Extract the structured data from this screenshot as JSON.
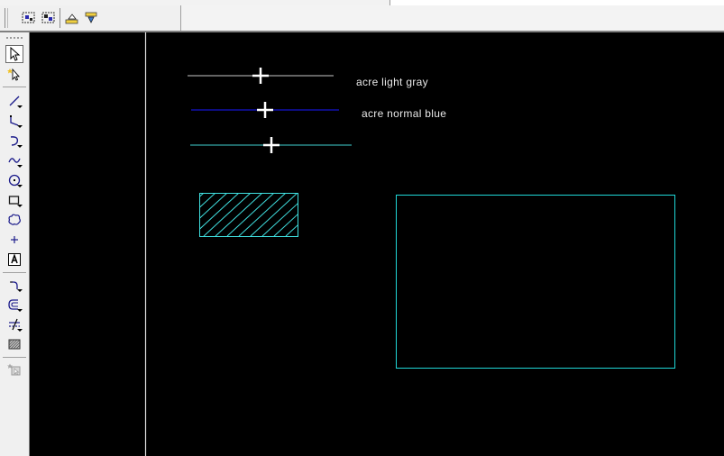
{
  "toolbar": {
    "buttons": [
      {
        "icon": "select-window-icon"
      },
      {
        "icon": "select-crossing-icon"
      },
      {
        "icon": "layer-raise-icon"
      },
      {
        "icon": "layer-lower-icon"
      }
    ]
  },
  "draw_tools": [
    {
      "icon": "pointer-icon",
      "active": true
    },
    {
      "icon": "magic-select-icon"
    },
    {
      "icon": "line-tool-icon"
    },
    {
      "icon": "polyline-tool-icon"
    },
    {
      "icon": "arc-tool-icon"
    },
    {
      "icon": "curve-tool-icon"
    },
    {
      "icon": "circle-tool-icon"
    },
    {
      "icon": "rectangle-tool-icon"
    },
    {
      "icon": "cloud-tool-icon"
    },
    {
      "icon": "point-tool-icon"
    },
    {
      "icon": "text-tool-icon"
    },
    {
      "icon": "fillet-tool-icon"
    },
    {
      "icon": "offset-tool-icon"
    },
    {
      "icon": "trim-tool-icon"
    },
    {
      "icon": "hatch-tool-icon"
    },
    {
      "icon": "disabled-edit-icon"
    }
  ],
  "canvas": {
    "background": "#000000",
    "lines": [
      {
        "name": "light-gray-line",
        "color": "#c8c8c8",
        "label": "acre light gray"
      },
      {
        "name": "normal-blue-line",
        "color": "#1a1aff",
        "label": "acre normal blue"
      },
      {
        "name": "cyan-line",
        "color": "#40d0d0",
        "label": ""
      }
    ],
    "shapes": {
      "hatched_rect_color": "#40e0e0",
      "rect_color": "#20d8d8",
      "divider_color": "#e0e0e0"
    }
  }
}
